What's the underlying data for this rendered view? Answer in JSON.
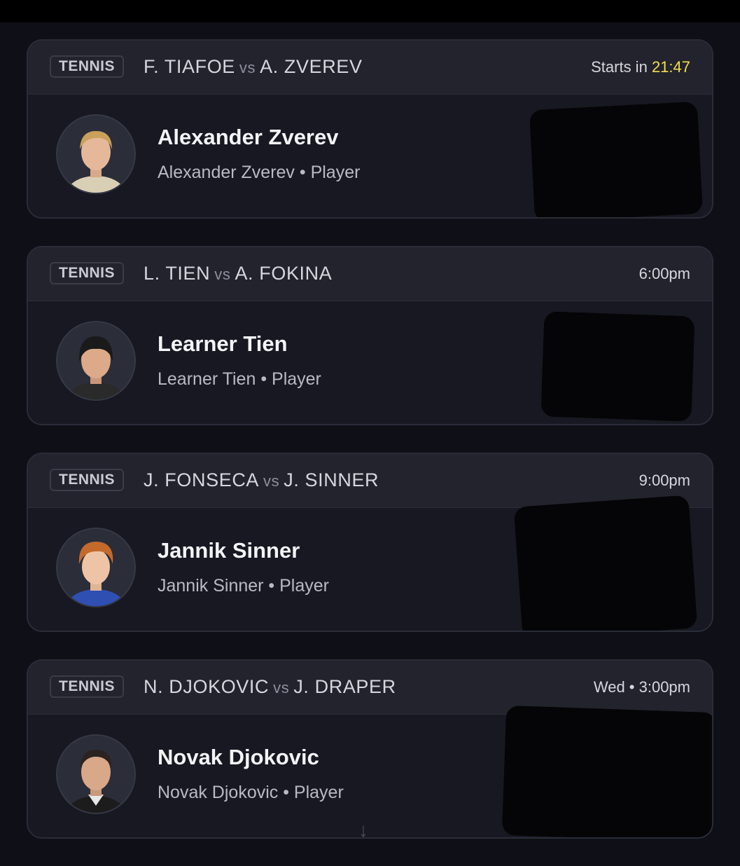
{
  "cards": [
    {
      "sport": "TENNIS",
      "player1": "F. TIAFOE",
      "vs": "vs",
      "player2": "A. ZVEREV",
      "time_prefix": "Starts in",
      "time": "21:47",
      "name": "Alexander Zverev",
      "subtitle": "Alexander Zverev • Player",
      "hair_color": "#c9a15a",
      "shirt_color": "#d9cfb4"
    },
    {
      "sport": "TENNIS",
      "player1": "L. TIEN",
      "vs": "vs",
      "player2": "A. FOKINA",
      "time_prefix": "",
      "time": "6:00pm",
      "name": "Learner Tien",
      "subtitle": "Learner Tien • Player",
      "hair_color": "#1a1a1a",
      "shirt_color": "#2a2a2a"
    },
    {
      "sport": "TENNIS",
      "player1": "J. FONSECA",
      "vs": "vs",
      "player2": "J. SINNER",
      "time_prefix": "",
      "time": "9:00pm",
      "name": "Jannik Sinner",
      "subtitle": "Jannik Sinner • Player",
      "hair_color": "#c46a2c",
      "shirt_color": "#2f4fb3"
    },
    {
      "sport": "TENNIS",
      "player1": "N. DJOKOVIC",
      "vs": "vs",
      "player2": "J. DRAPER",
      "time_prefix": "",
      "time": "Wed • 3:00pm",
      "name": "Novak Djokovic",
      "subtitle": "Novak Djokovic • Player",
      "hair_color": "#2a2320",
      "shirt_color": "#1c1c1c"
    }
  ],
  "colors": {
    "background": "#0f1017",
    "card": "#181922",
    "header": "#22232d",
    "accent": "#f2df4e"
  },
  "icons": {
    "scroll": "arrow-down-icon"
  }
}
